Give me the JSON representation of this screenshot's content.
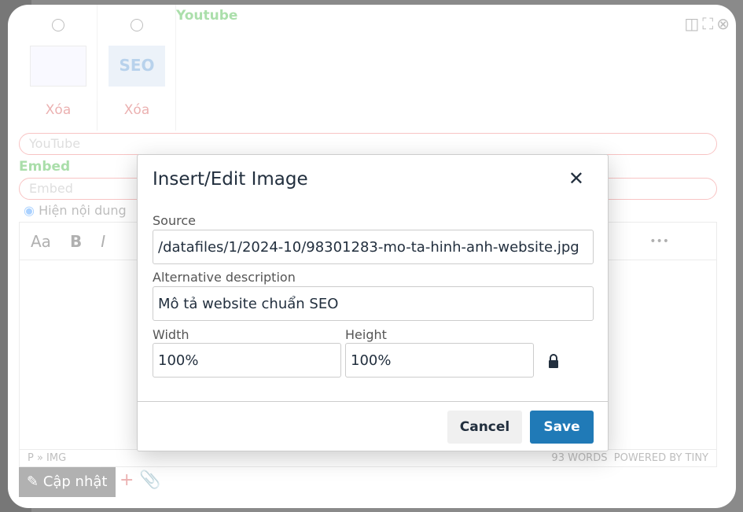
{
  "background": {
    "youtube_label": "Youtube",
    "youtube_placeholder": "YouTube",
    "embed_label": "Embed",
    "embed_placeholder": "Embed",
    "show_content_label": "Hiện nội dung",
    "images": [
      {
        "delete_label": "Xóa"
      },
      {
        "delete_label": "Xóa",
        "thumb_text": "SEO"
      }
    ],
    "editor": {
      "font_label": "Aa",
      "bold": "B",
      "italic": "I",
      "more": "•••",
      "path": "P » IMG",
      "word_count": "93 WORDS",
      "powered_by": "POWERED BY TINY"
    },
    "update_button": "Cập nhật"
  },
  "dialog": {
    "title": "Insert/Edit Image",
    "source_label": "Source",
    "source_value": "/datafiles/1/2024-10/98301283-mo-ta-hinh-anh-website.jpg",
    "alt_label": "Alternative description",
    "alt_value": "Mô tả website chuẩn SEO",
    "width_label": "Width",
    "width_value": "100%",
    "height_label": "Height",
    "height_value": "100%",
    "cancel_label": "Cancel",
    "save_label": "Save"
  },
  "colors": {
    "accent": "#207ab7",
    "text": "#222f3e"
  }
}
